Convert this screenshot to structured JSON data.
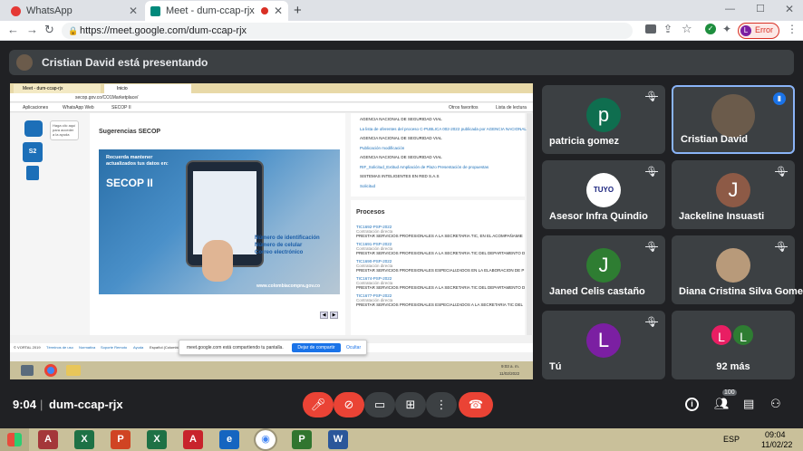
{
  "browser": {
    "tabs": [
      {
        "title": "WhatsApp",
        "active": false
      },
      {
        "title": "Meet - dum-ccap-rjx",
        "active": true
      }
    ],
    "new_tab_symbol": "+",
    "url": "https://meet.google.com/dum-ccap-rjx",
    "profile_initial": "L",
    "profile_status": "Error"
  },
  "meet": {
    "presenting_text": "Cristian David está presentando",
    "time": "9:04",
    "meeting_code": "dum-ccap-rjx",
    "participants_count": "100",
    "participants": [
      {
        "name": "patricia gomez",
        "initial": "p",
        "color": "#0f6e4f"
      },
      {
        "name": "Cristian David",
        "initial": "",
        "color": "#555555"
      },
      {
        "name": "Asesor Infra Quindio",
        "initial": "",
        "color": "#ffffff"
      },
      {
        "name": "Jackeline Insuasti",
        "initial": "J",
        "color": "#8d5a46"
      },
      {
        "name": "Janed Celis castaño",
        "initial": "J",
        "color": "#2e7d32"
      },
      {
        "name": "Diana Cristina Silva Gomez",
        "initial": "",
        "color": "#b89a7a"
      },
      {
        "name": "Tú",
        "initial": "L",
        "color": "#7b1fa2"
      }
    ],
    "more": {
      "label": "92 más",
      "initials": [
        "L",
        "L"
      ]
    }
  },
  "shared_screen": {
    "tabs": [
      "Meet - dum-ccap-rjx",
      "Inicio"
    ],
    "url": "secop.gov.co/CO1Marketplace/",
    "bookmarks": [
      "Aplicaciones",
      "WhatsApp Web",
      "SECOP II",
      "Otros favoritos",
      "Lista de lectura"
    ],
    "bot_bubble": "Haga clic aquí para acceder a la ayuda",
    "bot_label": "S2",
    "suggestions_title": "Sugerencias SECOP",
    "banner": {
      "line1": "Recuerda mantener actualizados tus datos en:",
      "brand": "SECOP II",
      "items": [
        "Número de identificación",
        "Número de celular",
        "Correo electrónico"
      ],
      "site": "www.colombiacompra.gov.co"
    },
    "notices": [
      "AGENCIA NACIONAL DE SEGURIDAD VIAL",
      "La lista de oferentes del proceso C-PUBLICA 002-2022 publicada por AGENCIA NACIONAL",
      "AGENCIA NACIONAL DE SEGURIDAD VIAL",
      "Publicación modificación",
      "AGENCIA NACIONAL DE SEGURIDAD VIAL",
      "RIF_Solicitud_Extitud Ampliación de Plazo Presentación de propuestas",
      "SISTEMAS INTELIGENTES EN RED S.A.S",
      "Solicitud"
    ],
    "procesos_title": "Procesos",
    "procesos": [
      {
        "code": "TIC1692-PSP-2022",
        "type": "Contratación directa",
        "desc": "PRESTAR SERVICIOS PROFESIONALES A LA SECRETARIA TIC, EN EL ACOMPAÑAMIE"
      },
      {
        "code": "TIC1691-PSP-2022",
        "type": "Contratación directa",
        "desc": "PRESTAR SERVICIOS PROFESIONALES A LA SECRETARIA TIC DEL DEPARTAMENTO D"
      },
      {
        "code": "TIC1690-PSP-2022",
        "type": "Contratación directa",
        "desc": "PRESTAR SERVICIOS PROFESIONALES ESPECIALIZADOS EN LA ELABORACION DE P"
      },
      {
        "code": "TIC1674-PSP-2022",
        "type": "Contratación directa",
        "desc": "PRESTAR SERVICIOS PROFESIONALES A LA SECRETARIA TIC DEL DEPARTAMENTO D"
      },
      {
        "code": "TIC1677-PSP-2022",
        "type": "Contratación directa",
        "desc": "PRESTAR SERVICIOS PROFESIONALES ESPECIALIZADOS A LA SECRETARIA TIC DEL"
      }
    ],
    "footer_links": [
      "© VORTAL 2019",
      "Términos de uso",
      "Normativa",
      "Soporte Remoto",
      "Ayuda",
      "Español (Colombia)"
    ],
    "share_notice": "meet.google.com está compartiendo tu pantalla.",
    "share_stop": "Dejar de compartir",
    "share_hide": "Ocultar",
    "inner_clock": "9:03 a. m.",
    "inner_date": "11/02/2022"
  },
  "taskbar": {
    "lang": "ESP",
    "time": "09:04",
    "date": "11/02/22",
    "apps": [
      {
        "label": "A",
        "color": "#a4373a"
      },
      {
        "label": "X",
        "color": "#1e7145"
      },
      {
        "label": "P",
        "color": "#d04423"
      },
      {
        "label": "X",
        "color": "#1e7145"
      },
      {
        "label": "A",
        "color": "#c8232c"
      },
      {
        "label": "e",
        "color": "#1565c0"
      },
      {
        "label": "◉",
        "color": "#4285f4"
      },
      {
        "label": "P",
        "color": "#31752f"
      },
      {
        "label": "W",
        "color": "#2b579a"
      }
    ]
  }
}
